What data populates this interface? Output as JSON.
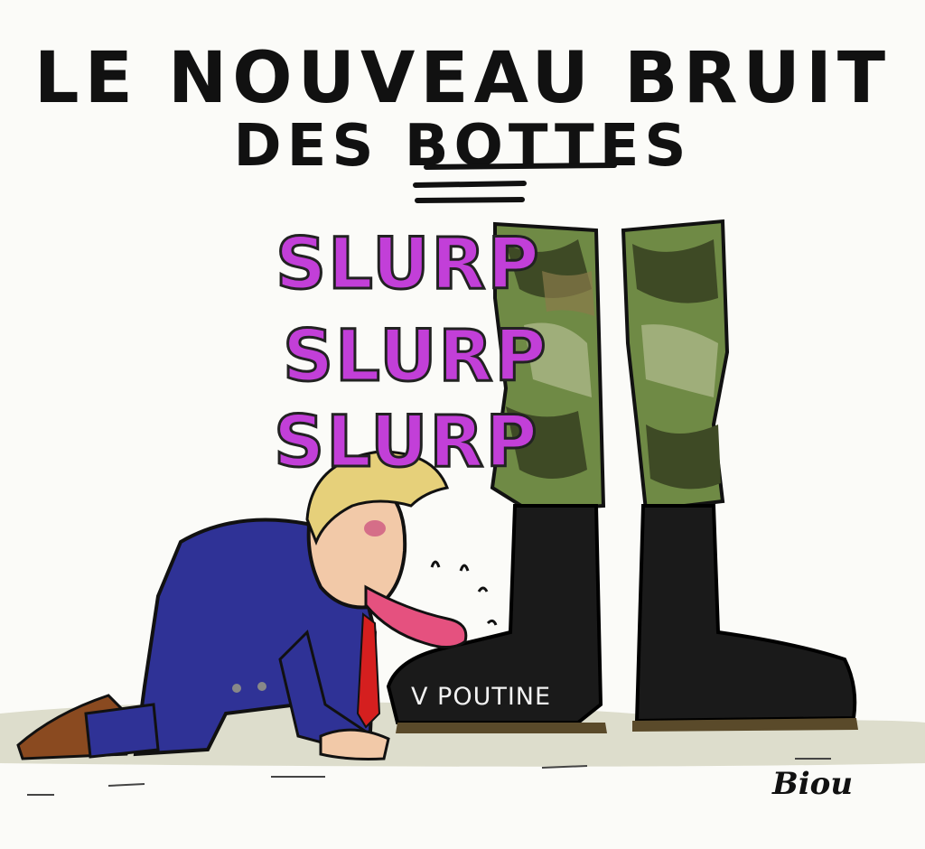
{
  "title": {
    "line1": "LE NOUVEAU BRUIT",
    "line2": "DES BOTTES"
  },
  "sound_effects": [
    "SLURP",
    "SLURP",
    "SLURP"
  ],
  "boot_label": "V POUTINE",
  "signature": "Biou",
  "colors": {
    "slurp": "#c23fd8",
    "suit": "#2f3296",
    "tie": "#d51f1f",
    "boot": "#1a1a1a",
    "camo_dark": "#3e4a25",
    "camo_mid": "#6f8a45",
    "camo_light": "#9fae7a",
    "tongue": "#e5517f",
    "hair": "#e6d07a",
    "ground": "#c9c9ad"
  }
}
